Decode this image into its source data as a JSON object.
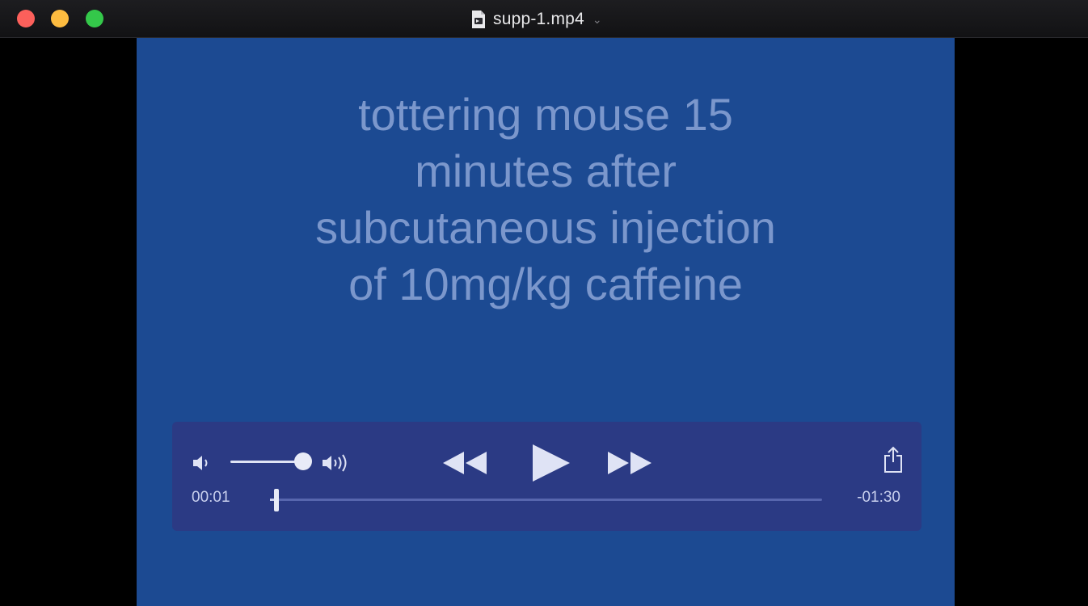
{
  "window": {
    "title": "supp-1.mp4",
    "title_chevron": "⌄"
  },
  "video": {
    "caption_lines": [
      "tottering mouse 15",
      "minutes after",
      "subcutaneous injection",
      "of 10mg/kg caffeine"
    ]
  },
  "controls": {
    "elapsed": "00:01",
    "remaining": "-01:30",
    "playback_fraction": 0.011,
    "volume_fraction": 1.0
  },
  "colors": {
    "video_background": "#1c4a92",
    "caption_text": "#7b97cc",
    "controls_background": "#2b3a84",
    "close": "#fc605b",
    "minimize": "#fdbc40",
    "zoom": "#34c84a"
  },
  "icons": [
    "close-icon",
    "minimize-icon",
    "zoom-icon",
    "document-icon",
    "chevron-down-icon",
    "volume-low-icon",
    "volume-high-icon",
    "rewind-icon",
    "play-icon",
    "fast-forward-icon",
    "share-icon"
  ]
}
